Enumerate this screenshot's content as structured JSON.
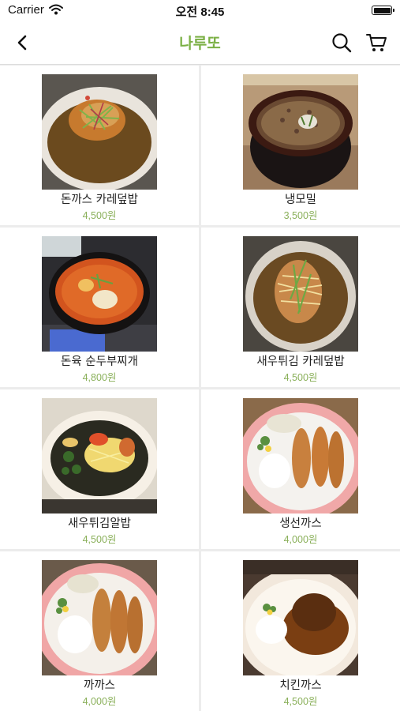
{
  "status_bar": {
    "carrier": "Carrier",
    "time": "오전 8:45"
  },
  "nav": {
    "title": "나루또"
  },
  "menu_items": [
    {
      "name": "돈까스 카레덮밥",
      "price": "4,500원"
    },
    {
      "name": "냉모밀",
      "price": "3,500원"
    },
    {
      "name": "돈육 순두부찌개",
      "price": "4,800원"
    },
    {
      "name": "새우튀김 카레덮밥",
      "price": "4,500원"
    },
    {
      "name": "새우튀김알밥",
      "price": "4,500원"
    },
    {
      "name": "생선까스",
      "price": "4,000원"
    },
    {
      "name": "까까스",
      "price": "4,000원"
    },
    {
      "name": "치킨까스",
      "price": "4,500원"
    }
  ]
}
